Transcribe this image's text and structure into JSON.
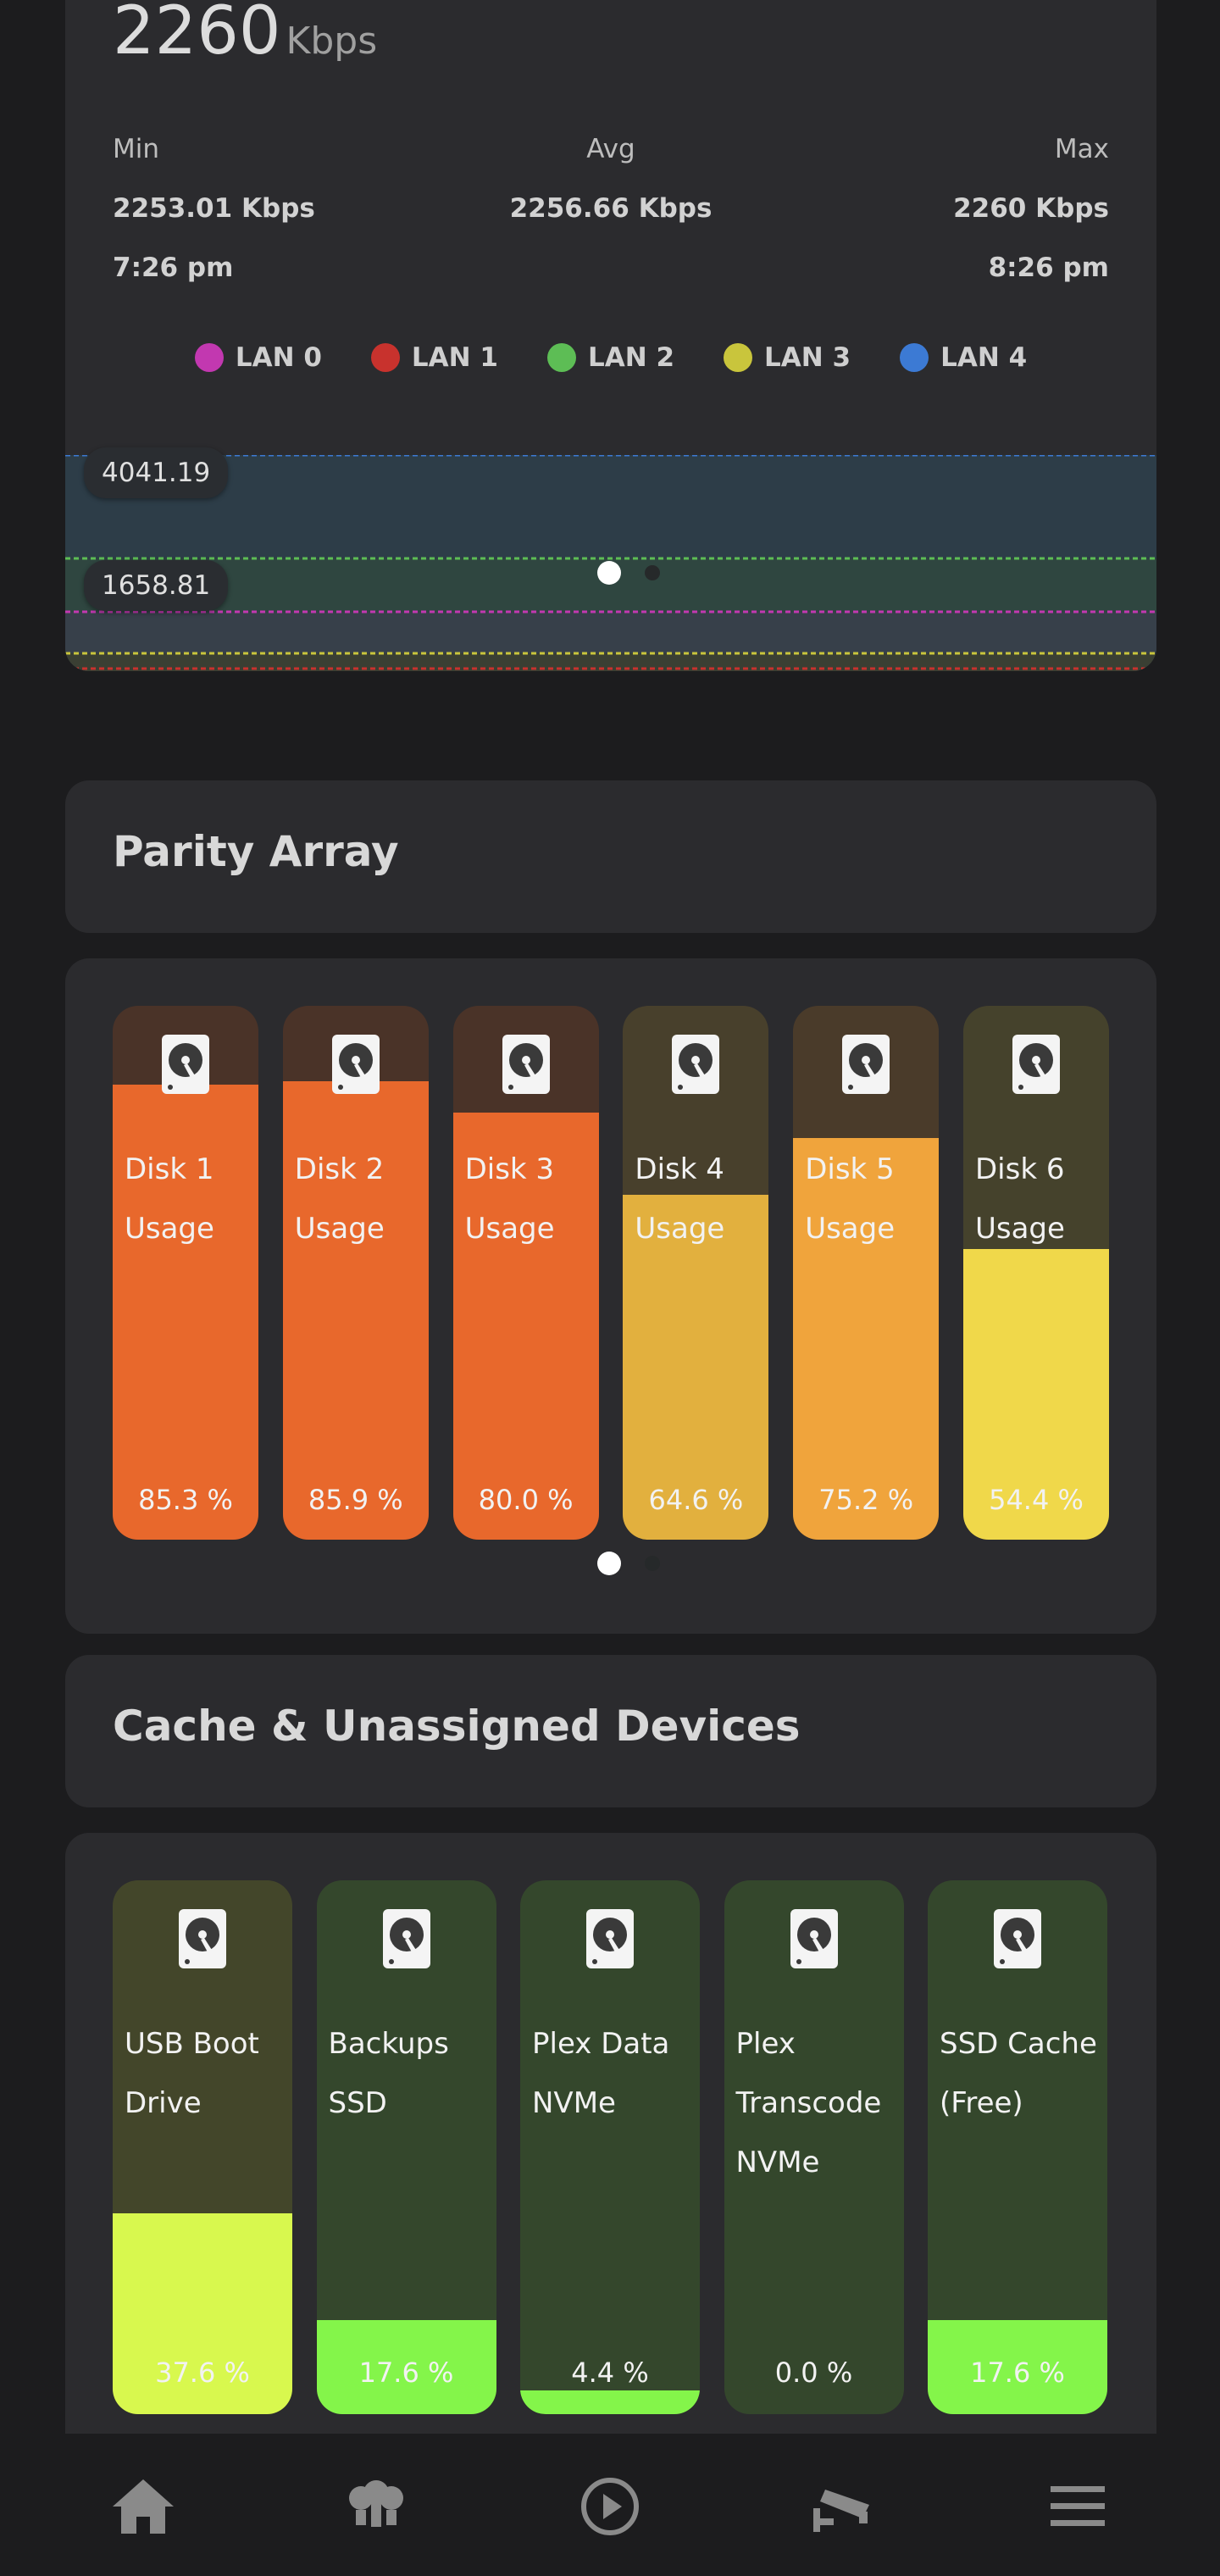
{
  "network": {
    "value": "2260",
    "unit": "Kbps",
    "min_label": "Min",
    "avg_label": "Avg",
    "max_label": "Max",
    "min_value": "2253.01 Kbps",
    "avg_value": "2256.66 Kbps",
    "max_value": "2260 Kbps",
    "start_time": "7:26 pm",
    "end_time": "8:26 pm",
    "legend": [
      {
        "label": "LAN 0",
        "color": "#c238b0"
      },
      {
        "label": "LAN 1",
        "color": "#c8322d"
      },
      {
        "label": "LAN 2",
        "color": "#5dbd55"
      },
      {
        "label": "LAN 3",
        "color": "#c9c53c"
      },
      {
        "label": "LAN 4",
        "color": "#3c7ad4"
      }
    ],
    "marker_high": "4041.19",
    "marker_low": "1658.81"
  },
  "parity": {
    "title": "Parity Array",
    "disks": [
      {
        "name": "Disk 1\nUsage",
        "pct": "85.3 %",
        "usage": 85.3,
        "color": "#e8682c",
        "bg": "#4a3328"
      },
      {
        "name": "Disk 2\nUsage",
        "pct": "85.9 %",
        "usage": 85.9,
        "color": "#e8682c",
        "bg": "#4a3328"
      },
      {
        "name": "Disk 3\nUsage",
        "pct": "80.0 %",
        "usage": 80.0,
        "color": "#e8682c",
        "bg": "#4a3328"
      },
      {
        "name": "Disk 4\nUsage",
        "pct": "64.6 %",
        "usage": 64.6,
        "color": "#e2b03e",
        "bg": "#48402c"
      },
      {
        "name": "Disk 5\nUsage",
        "pct": "75.2 %",
        "usage": 75.2,
        "color": "#f0a43c",
        "bg": "#4a3b2a"
      },
      {
        "name": "Disk 6\nUsage",
        "pct": "54.4 %",
        "usage": 54.4,
        "color": "#f0d84a",
        "bg": "#45422c"
      }
    ]
  },
  "cache": {
    "title": "Cache & Unassigned Devices",
    "devices": [
      {
        "lines": [
          "USB Boot",
          "Drive"
        ],
        "pct": "37.6 %",
        "usage": 37.6,
        "color": "#d8f84e",
        "bg": "#43462a"
      },
      {
        "lines": [
          "Backups",
          "SSD"
        ],
        "pct": "17.6 %",
        "usage": 17.6,
        "color": "#84f54a",
        "bg": "#34472c"
      },
      {
        "lines": [
          "Plex Data",
          "NVMe"
        ],
        "pct": "4.4 %",
        "usage": 4.4,
        "color": "#84f54a",
        "bg": "#34472c"
      },
      {
        "lines": [
          "Plex",
          "Transcode",
          "NVMe"
        ],
        "pct": "0.0 %",
        "usage": 0.0,
        "color": "#84f54a",
        "bg": "#34472c"
      },
      {
        "lines": [
          "SSD Cache",
          "(Free)"
        ],
        "pct": "17.6 %",
        "usage": 17.6,
        "color": "#84f54a",
        "bg": "#34472c"
      }
    ]
  },
  "nav": {
    "icons": [
      "home-icon",
      "lightbulbs-icon",
      "play-icon",
      "security-camera-icon",
      "menu-icon"
    ]
  }
}
